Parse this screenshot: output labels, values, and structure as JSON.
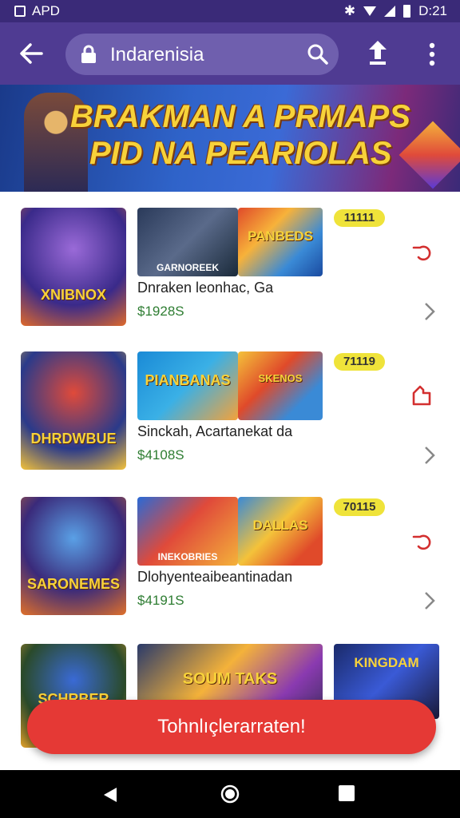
{
  "status": {
    "label": "APD",
    "time": "D:21"
  },
  "toolbar": {
    "url": "Indarenisia"
  },
  "banner": {
    "line1": "BRAKMAN A PRMAPS",
    "line2": "PID NA PEARIOLAS"
  },
  "items": [
    {
      "thumb_caption": "XNIBNOX",
      "shot1_caption": "GARNOREEK",
      "shot2_caption": "PANBEDS",
      "badge": "11111",
      "name": "Dnraken leonhac, Ga",
      "price": "$1928S"
    },
    {
      "thumb_caption": "DHRDWBUE",
      "shot1_caption": "PIANBANAS",
      "shot2_caption": "SKENOS",
      "badge": "71119",
      "name": "Sinckah, Acartanekat da",
      "price": "$4108S"
    },
    {
      "thumb_caption": "SARONEMES",
      "shot1_caption": "INEKOBRIES",
      "shot2_caption": "DALLAS",
      "badge": "70115",
      "name": "Dlohyenteaibeantinadan",
      "price": "$4191S"
    }
  ],
  "bottom_items": {
    "thumb_caption": "SCHRBER",
    "shot1_caption": "SOUM TAKS",
    "shot3_caption": "KINGDAM"
  },
  "cta": {
    "label": "Tohnlıçlerarraten!"
  },
  "colors": {
    "statusbar": "#3a2a78",
    "appbar": "#4f3b92",
    "cta": "#e53935",
    "price": "#2e7d32",
    "badge": "#efe33a"
  }
}
